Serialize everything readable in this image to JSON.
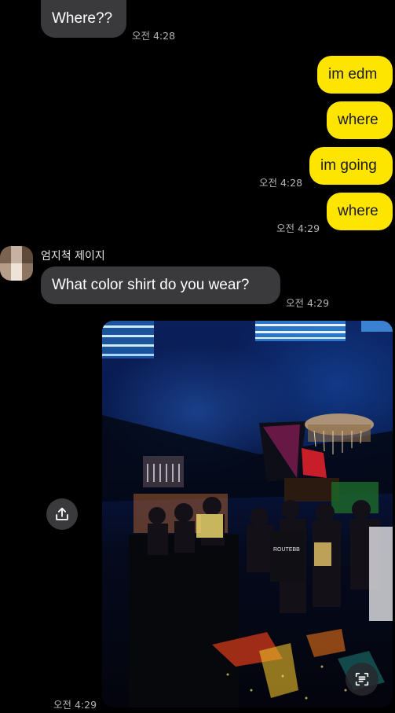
{
  "messages": [
    {
      "text": "Where??",
      "time": "오전 4:28"
    },
    {
      "text": "im edm"
    },
    {
      "text": "where"
    },
    {
      "text": "im going",
      "time": "오전 4:28"
    },
    {
      "text": "where",
      "time": "오전 4:29"
    },
    {
      "text": "What color shirt do you wear?",
      "time": "오전 4:29"
    }
  ],
  "sender": {
    "name": "엄지척 제이지"
  },
  "photo": {
    "time": "오전 4:29",
    "sign_text": "ROUTEBB"
  },
  "icons": {
    "share": "share-icon",
    "scan": "text-scan-icon"
  },
  "colors": {
    "outgoing_bubble": "#fee500",
    "incoming_bubble": "#3a3a3c",
    "background": "#000000"
  }
}
